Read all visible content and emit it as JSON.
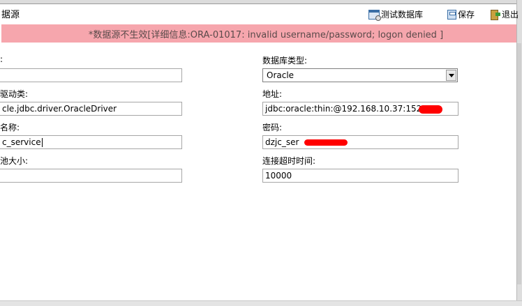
{
  "page": {
    "title": "据源"
  },
  "toolbar": {
    "test_db_label": "测试数据库",
    "save_label": "保存",
    "exit_label": "退出"
  },
  "banner": {
    "message": "*数据源不生效[详细信息:ORA-01017: invalid username/password; logon denied ]"
  },
  "form": {
    "name": {
      "label": ":",
      "value": ""
    },
    "db_type": {
      "label": "数据库类型:",
      "value": "Oracle"
    },
    "driver": {
      "label": "驱动类:",
      "value": "cle.jdbc.driver.OracleDriver"
    },
    "address": {
      "label": "地址:",
      "value": "jdbc:oracle:thin:@192.168.10.37:1521"
    },
    "username": {
      "label": "名称:",
      "value": "c_service"
    },
    "password": {
      "label": "密码:",
      "value": "dzjc_ser"
    },
    "pool_size": {
      "label": "池大小:",
      "value": ""
    },
    "timeout": {
      "label": "连接超时时间:",
      "value": "10000"
    }
  },
  "colors": {
    "banner_bg": "#f6a6ad",
    "redaction": "#ff0000"
  }
}
